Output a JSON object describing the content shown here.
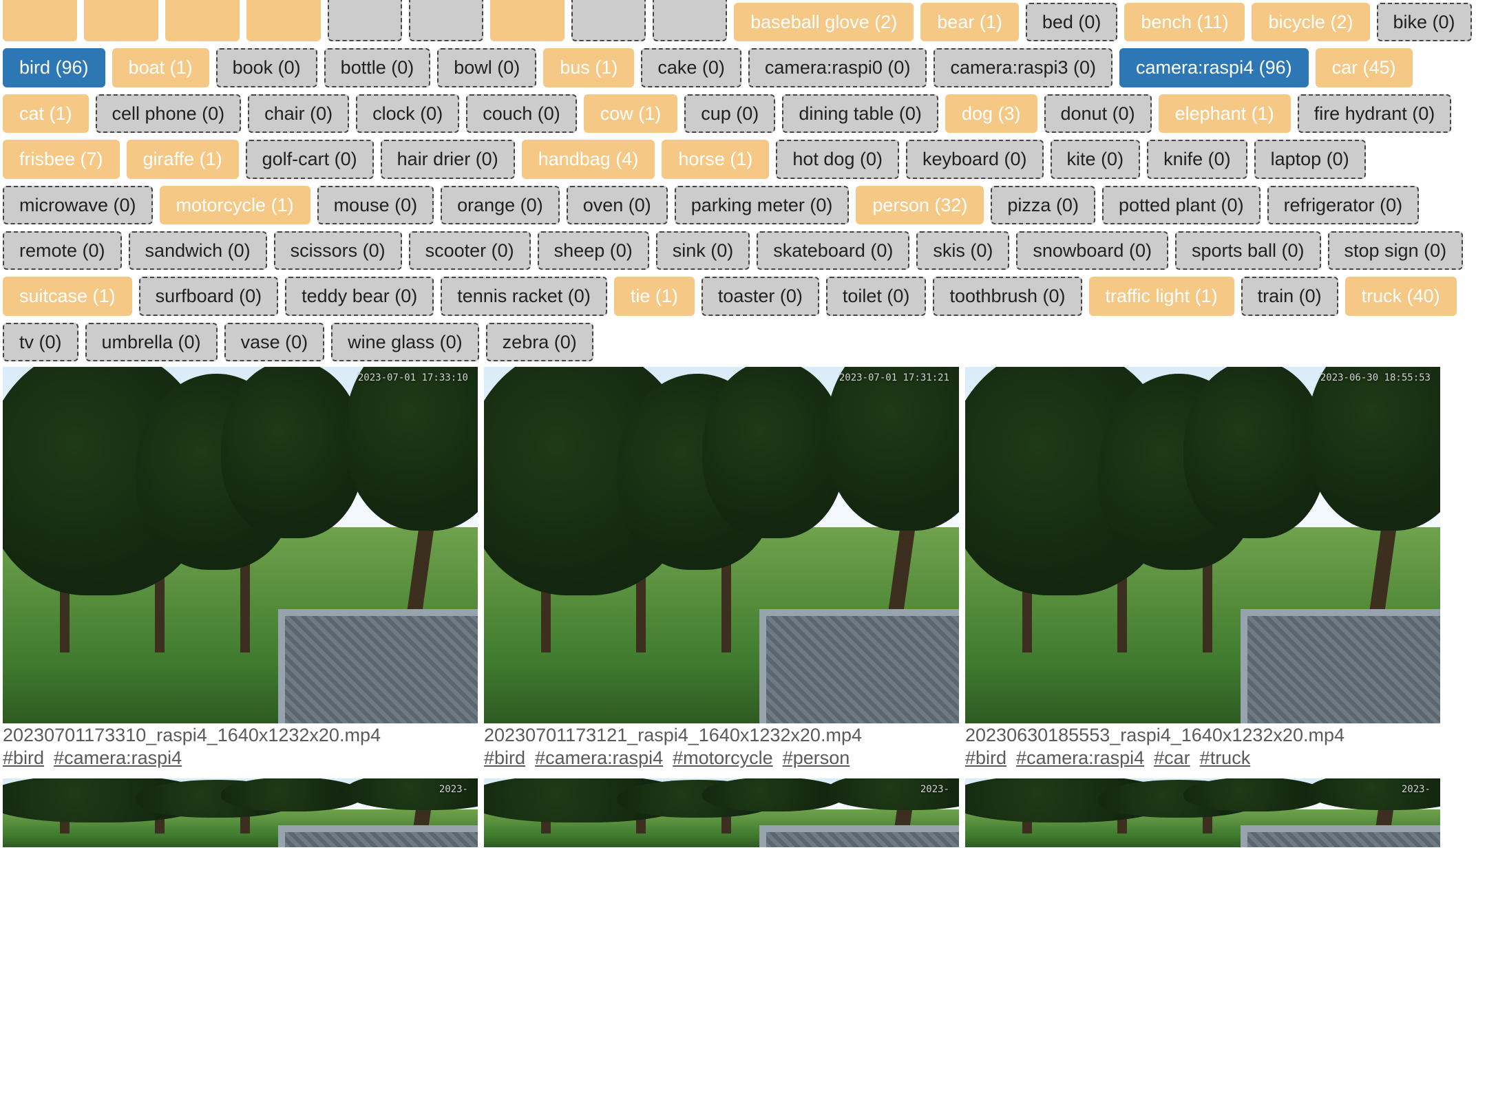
{
  "tags": [
    {
      "label": "",
      "count": null,
      "style": "orange",
      "cut": true
    },
    {
      "label": "",
      "count": null,
      "style": "orange",
      "cut": true
    },
    {
      "label": "",
      "count": null,
      "style": "orange",
      "cut": true
    },
    {
      "label": "",
      "count": null,
      "style": "orange",
      "cut": true
    },
    {
      "label": "",
      "count": null,
      "style": "gray",
      "cut": true
    },
    {
      "label": "",
      "count": null,
      "style": "gray",
      "cut": true
    },
    {
      "label": "",
      "count": null,
      "style": "orange",
      "cut": true
    },
    {
      "label": "",
      "count": null,
      "style": "gray",
      "cut": true
    },
    {
      "label": "",
      "count": null,
      "style": "gray",
      "cut": true
    },
    {
      "label": "baseball glove",
      "count": 2,
      "style": "orange"
    },
    {
      "label": "bear",
      "count": 1,
      "style": "orange"
    },
    {
      "label": "bed",
      "count": 0,
      "style": "gray"
    },
    {
      "label": "bench",
      "count": 11,
      "style": "orange"
    },
    {
      "label": "bicycle",
      "count": 2,
      "style": "orange"
    },
    {
      "label": "bike",
      "count": 0,
      "style": "gray"
    },
    {
      "label": "bird",
      "count": 96,
      "style": "blue"
    },
    {
      "label": "boat",
      "count": 1,
      "style": "orange"
    },
    {
      "label": "book",
      "count": 0,
      "style": "gray"
    },
    {
      "label": "bottle",
      "count": 0,
      "style": "gray"
    },
    {
      "label": "bowl",
      "count": 0,
      "style": "gray"
    },
    {
      "label": "bus",
      "count": 1,
      "style": "orange"
    },
    {
      "label": "cake",
      "count": 0,
      "style": "gray"
    },
    {
      "label": "camera:raspi0",
      "count": 0,
      "style": "gray"
    },
    {
      "label": "camera:raspi3",
      "count": 0,
      "style": "gray"
    },
    {
      "label": "camera:raspi4",
      "count": 96,
      "style": "blue"
    },
    {
      "label": "car",
      "count": 45,
      "style": "orange"
    },
    {
      "label": "cat",
      "count": 1,
      "style": "orange"
    },
    {
      "label": "cell phone",
      "count": 0,
      "style": "gray"
    },
    {
      "label": "chair",
      "count": 0,
      "style": "gray"
    },
    {
      "label": "clock",
      "count": 0,
      "style": "gray"
    },
    {
      "label": "couch",
      "count": 0,
      "style": "gray"
    },
    {
      "label": "cow",
      "count": 1,
      "style": "orange"
    },
    {
      "label": "cup",
      "count": 0,
      "style": "gray"
    },
    {
      "label": "dining table",
      "count": 0,
      "style": "gray"
    },
    {
      "label": "dog",
      "count": 3,
      "style": "orange"
    },
    {
      "label": "donut",
      "count": 0,
      "style": "gray"
    },
    {
      "label": "elephant",
      "count": 1,
      "style": "orange"
    },
    {
      "label": "fire hydrant",
      "count": 0,
      "style": "gray"
    },
    {
      "label": "frisbee",
      "count": 7,
      "style": "orange"
    },
    {
      "label": "giraffe",
      "count": 1,
      "style": "orange"
    },
    {
      "label": "golf-cart",
      "count": 0,
      "style": "gray"
    },
    {
      "label": "hair drier",
      "count": 0,
      "style": "gray"
    },
    {
      "label": "handbag",
      "count": 4,
      "style": "orange"
    },
    {
      "label": "horse",
      "count": 1,
      "style": "orange"
    },
    {
      "label": "hot dog",
      "count": 0,
      "style": "gray"
    },
    {
      "label": "keyboard",
      "count": 0,
      "style": "gray"
    },
    {
      "label": "kite",
      "count": 0,
      "style": "gray"
    },
    {
      "label": "knife",
      "count": 0,
      "style": "gray"
    },
    {
      "label": "laptop",
      "count": 0,
      "style": "gray"
    },
    {
      "label": "microwave",
      "count": 0,
      "style": "gray"
    },
    {
      "label": "motorcycle",
      "count": 1,
      "style": "orange"
    },
    {
      "label": "mouse",
      "count": 0,
      "style": "gray"
    },
    {
      "label": "orange",
      "count": 0,
      "style": "gray"
    },
    {
      "label": "oven",
      "count": 0,
      "style": "gray"
    },
    {
      "label": "parking meter",
      "count": 0,
      "style": "gray"
    },
    {
      "label": "person",
      "count": 32,
      "style": "orange"
    },
    {
      "label": "pizza",
      "count": 0,
      "style": "gray"
    },
    {
      "label": "potted plant",
      "count": 0,
      "style": "gray"
    },
    {
      "label": "refrigerator",
      "count": 0,
      "style": "gray"
    },
    {
      "label": "remote",
      "count": 0,
      "style": "gray"
    },
    {
      "label": "sandwich",
      "count": 0,
      "style": "gray"
    },
    {
      "label": "scissors",
      "count": 0,
      "style": "gray"
    },
    {
      "label": "scooter",
      "count": 0,
      "style": "gray"
    },
    {
      "label": "sheep",
      "count": 0,
      "style": "gray"
    },
    {
      "label": "sink",
      "count": 0,
      "style": "gray"
    },
    {
      "label": "skateboard",
      "count": 0,
      "style": "gray"
    },
    {
      "label": "skis",
      "count": 0,
      "style": "gray"
    },
    {
      "label": "snowboard",
      "count": 0,
      "style": "gray"
    },
    {
      "label": "sports ball",
      "count": 0,
      "style": "gray"
    },
    {
      "label": "stop sign",
      "count": 0,
      "style": "gray"
    },
    {
      "label": "suitcase",
      "count": 1,
      "style": "orange"
    },
    {
      "label": "surfboard",
      "count": 0,
      "style": "gray"
    },
    {
      "label": "teddy bear",
      "count": 0,
      "style": "gray"
    },
    {
      "label": "tennis racket",
      "count": 0,
      "style": "gray"
    },
    {
      "label": "tie",
      "count": 1,
      "style": "orange"
    },
    {
      "label": "toaster",
      "count": 0,
      "style": "gray"
    },
    {
      "label": "toilet",
      "count": 0,
      "style": "gray"
    },
    {
      "label": "toothbrush",
      "count": 0,
      "style": "gray"
    },
    {
      "label": "traffic light",
      "count": 1,
      "style": "orange"
    },
    {
      "label": "train",
      "count": 0,
      "style": "gray"
    },
    {
      "label": "truck",
      "count": 40,
      "style": "orange"
    },
    {
      "label": "tv",
      "count": 0,
      "style": "gray"
    },
    {
      "label": "umbrella",
      "count": 0,
      "style": "gray"
    },
    {
      "label": "vase",
      "count": 0,
      "style": "gray"
    },
    {
      "label": "wine glass",
      "count": 0,
      "style": "gray"
    },
    {
      "label": "zebra",
      "count": 0,
      "style": "gray"
    }
  ],
  "videos": [
    {
      "filename": "20230701173310_raspi4_1640x1232x20.mp4",
      "timestamp": "2023-07-01 17:33:10",
      "hashtags": [
        "#bird",
        "#camera:raspi4"
      ]
    },
    {
      "filename": "20230701173121_raspi4_1640x1232x20.mp4",
      "timestamp": "2023-07-01 17:31:21",
      "hashtags": [
        "#bird",
        "#camera:raspi4",
        "#motorcycle",
        "#person"
      ]
    },
    {
      "filename": "20230630185553_raspi4_1640x1232x20.mp4",
      "timestamp": "2023-06-30 18:55:53",
      "hashtags": [
        "#bird",
        "#camera:raspi4",
        "#car",
        "#truck"
      ]
    }
  ],
  "videos_row2": [
    {
      "timestamp": "2023-"
    },
    {
      "timestamp": "2023-"
    },
    {
      "timestamp": "2023-"
    }
  ]
}
